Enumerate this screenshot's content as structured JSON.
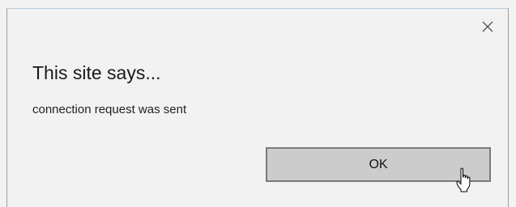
{
  "dialog": {
    "close_icon": "close-icon",
    "title": "This site says...",
    "message": "connection request was sent",
    "ok_label": "OK"
  },
  "cursor": {
    "icon": "hand-pointer-icon"
  }
}
